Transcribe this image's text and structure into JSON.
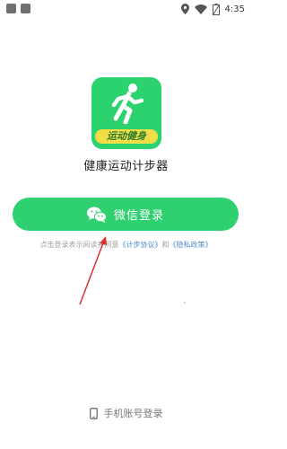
{
  "status_bar": {
    "time": "4:35",
    "icons": [
      "location-icon",
      "wifi-icon",
      "battery-icon"
    ]
  },
  "app": {
    "icon_name": "running-man-icon",
    "badge_text": "运动健身",
    "name": "健康运动计步器",
    "accent_color": "#2fd06f"
  },
  "wechat_login": {
    "label": "微信登录",
    "icon": "wechat-icon"
  },
  "agreement": {
    "prefix": "点击登录表示阅读并同意",
    "link1": "《计步协议》",
    "connector": "和",
    "link2": "《隐私政策》"
  },
  "phone_login": {
    "label": "手机账号登录",
    "icon": "phone-icon"
  }
}
